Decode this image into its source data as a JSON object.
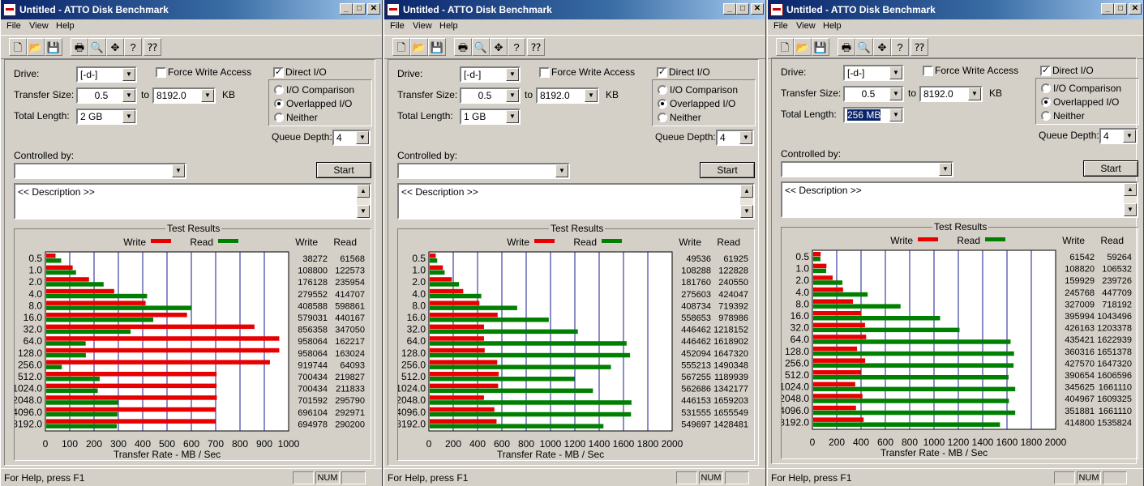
{
  "menu": [
    "File",
    "View",
    "Help"
  ],
  "toolbar_icons": [
    "new-icon",
    "open-icon",
    "save-icon",
    "print-icon",
    "print-preview-icon",
    "move-icon",
    "help-icon",
    "context-help-icon"
  ],
  "colors": {
    "write": "#e80000",
    "read": "#008000",
    "grid": "#1a1a8c"
  },
  "windows": [
    {
      "title": "Untitled - ATTO Disk Benchmark",
      "drive_label": "Drive:",
      "drive": "[-d-]",
      "force_write_label": "Force Write Access",
      "force_write": false,
      "direct_io_label": "Direct I/O",
      "direct_io": true,
      "transfer_size_label": "Transfer Size:",
      "transfer_from": "0.5",
      "to_label": "to",
      "transfer_to": "8192.0",
      "kb_label": "KB",
      "total_length_label": "Total Length:",
      "total_length": "2 GB",
      "total_length_selected": false,
      "io_comparison_label": "I/O Comparison",
      "overlapped_label": "Overlapped I/O",
      "neither_label": "Neither",
      "mode": "overlapped",
      "queue_depth_label": "Queue Depth:",
      "queue_depth": "4",
      "controlled_by_label": "Controlled by:",
      "controlled_by": "",
      "start_label": "Start",
      "description": "<< Description >>",
      "results_title": "Test Results",
      "legend_write": "Write",
      "legend_read": "Read",
      "col_write": "Write",
      "col_read": "Read",
      "status": "For Help, press F1",
      "num": "NUM",
      "chart_data": {
        "type": "bar",
        "orientation": "horizontal",
        "xlabel": "Transfer Rate - MB / Sec",
        "xlim": [
          0,
          1000
        ],
        "xticks": [
          "0",
          "100",
          "200",
          "300",
          "400",
          "500",
          "600",
          "700",
          "800",
          "900",
          "1000"
        ],
        "categories": [
          "0.5",
          "1.0",
          "2.0",
          "4.0",
          "8.0",
          "16.0",
          "32.0",
          "64.0",
          "128.0",
          "256.0",
          "512.0",
          "1024.0",
          "2048.0",
          "4096.0",
          "8192.0"
        ],
        "series": [
          {
            "name": "Write",
            "values": [
              38272,
              108800,
              176128,
              279552,
              408588,
              579031,
              856358,
              958064,
              958064,
              919744,
              700434,
              700434,
              701592,
              696104,
              694978
            ],
            "labels": [
              "38272",
              "108800",
              "176128",
              "279552",
              "408588",
              "579031",
              "856358",
              "958064",
              "958064",
              "919744",
              "700434",
              "700434",
              "701592",
              "696104",
              "694978"
            ]
          },
          {
            "name": "Read",
            "values": [
              61568,
              122573,
              235954,
              414707,
              598861,
              440167,
              347050,
              162217,
              163024,
              64093,
              219827,
              211833,
              295790,
              292971,
              290200
            ],
            "labels": [
              "61568",
              "122573",
              "235954",
              "414707",
              "598861",
              "440167",
              "347050",
              "162217",
              "163024",
              "64093",
              "219827",
              "211833",
              "295790",
              "292971",
              "290200"
            ]
          }
        ]
      }
    },
    {
      "title": "Untitled - ATTO Disk Benchmark",
      "drive_label": "Drive:",
      "drive": "[-d-]",
      "force_write_label": "Force Write Access",
      "force_write": false,
      "direct_io_label": "Direct I/O",
      "direct_io": true,
      "transfer_size_label": "Transfer Size:",
      "transfer_from": "0.5",
      "to_label": "to",
      "transfer_to": "8192.0",
      "kb_label": "KB",
      "total_length_label": "Total Length:",
      "total_length": "1 GB",
      "total_length_selected": false,
      "io_comparison_label": "I/O Comparison",
      "overlapped_label": "Overlapped I/O",
      "neither_label": "Neither",
      "mode": "overlapped",
      "queue_depth_label": "Queue Depth:",
      "queue_depth": "4",
      "controlled_by_label": "Controlled by:",
      "controlled_by": "",
      "start_label": "Start",
      "description": "<< Description >>",
      "results_title": "Test Results",
      "legend_write": "Write",
      "legend_read": "Read",
      "col_write": "Write",
      "col_read": "Read",
      "status": "For Help, press F1",
      "num": "NUM",
      "chart_data": {
        "type": "bar",
        "orientation": "horizontal",
        "xlabel": "Transfer Rate - MB / Sec",
        "xlim": [
          0,
          2000
        ],
        "xticks": [
          "0",
          "200",
          "400",
          "600",
          "800",
          "1000",
          "1200",
          "1400",
          "1600",
          "1800",
          "2000"
        ],
        "categories": [
          "0.5",
          "1.0",
          "2.0",
          "4.0",
          "8.0",
          "16.0",
          "32.0",
          "64.0",
          "128.0",
          "256.0",
          "512.0",
          "1024.0",
          "2048.0",
          "4096.0",
          "8192.0"
        ],
        "series": [
          {
            "name": "Write",
            "values": [
              49536,
              108288,
              181760,
              275603,
              408734,
              558653,
              446462,
              446462,
              452094,
              555213,
              567255,
              562686,
              446153,
              531555,
              549697
            ],
            "labels": [
              "49536",
              "108288",
              "181760",
              "275603",
              "408734",
              "558653",
              "446462",
              "446462",
              "452094",
              "555213",
              "567255",
              "562686",
              "446153",
              "531555",
              "549697"
            ]
          },
          {
            "name": "Read",
            "values": [
              61925,
              122828,
              240550,
              424047,
              719392,
              978986,
              1218152,
              1618902,
              1647320,
              1490348,
              1189939,
              1342177,
              1659203,
              1655549,
              1428481
            ],
            "labels": [
              "61925",
              "122828",
              "240550",
              "424047",
              "719392",
              "978986",
              "1218152",
              "1618902",
              "1647320",
              "1490348",
              "1189939",
              "1342177",
              "1659203",
              "1655549",
              "1428481"
            ]
          }
        ]
      }
    },
    {
      "title": "Untitled - ATTO Disk Benchmark",
      "drive_label": "Drive:",
      "drive": "[-d-]",
      "force_write_label": "Force Write Access",
      "force_write": false,
      "direct_io_label": "Direct I/O",
      "direct_io": true,
      "transfer_size_label": "Transfer Size:",
      "transfer_from": "0.5",
      "to_label": "to",
      "transfer_to": "8192.0",
      "kb_label": "KB",
      "total_length_label": "Total Length:",
      "total_length": "256 MB",
      "total_length_selected": true,
      "io_comparison_label": "I/O Comparison",
      "overlapped_label": "Overlapped I/O",
      "neither_label": "Neither",
      "mode": "overlapped",
      "queue_depth_label": "Queue Depth:",
      "queue_depth": "4",
      "controlled_by_label": "Controlled by:",
      "controlled_by": "",
      "start_label": "Start",
      "description": "<< Description >>",
      "results_title": "Test Results",
      "legend_write": "Write",
      "legend_read": "Read",
      "col_write": "Write",
      "col_read": "Read",
      "status": "For Help, press F1",
      "num": "NUM",
      "chart_data": {
        "type": "bar",
        "orientation": "horizontal",
        "xlabel": "Transfer Rate - MB / Sec",
        "xlim": [
          0,
          2000
        ],
        "xticks": [
          "0",
          "200",
          "400",
          "600",
          "800",
          "1000",
          "1200",
          "1400",
          "1600",
          "1800",
          "2000"
        ],
        "categories": [
          "0.5",
          "1.0",
          "2.0",
          "4.0",
          "8.0",
          "16.0",
          "32.0",
          "64.0",
          "128.0",
          "256.0",
          "512.0",
          "1024.0",
          "2048.0",
          "4096.0",
          "8192.0"
        ],
        "series": [
          {
            "name": "Write",
            "values": [
              61542,
              108820,
              159929,
              245768,
              327009,
              395994,
              426163,
              435421,
              360316,
              427570,
              390654,
              345625,
              404967,
              351881,
              414800
            ],
            "labels": [
              "61542",
              "108820",
              "159929",
              "245768",
              "327009",
              "395994",
              "426163",
              "435421",
              "360316",
              "427570",
              "390654",
              "345625",
              "404967",
              "351881",
              "414800"
            ]
          },
          {
            "name": "Read",
            "values": [
              59264,
              106532,
              239726,
              447709,
              718192,
              1043496,
              1203378,
              1622939,
              1651378,
              1647320,
              1606596,
              1661110,
              1609325,
              1661110,
              1535824
            ],
            "labels": [
              "59264",
              "106532",
              "239726",
              "447709",
              "718192",
              "1043496",
              "1203378",
              "1622939",
              "1651378",
              "1647320",
              "1606596",
              "1661110",
              "1609325",
              "1661110",
              "1535824"
            ]
          }
        ]
      }
    }
  ]
}
